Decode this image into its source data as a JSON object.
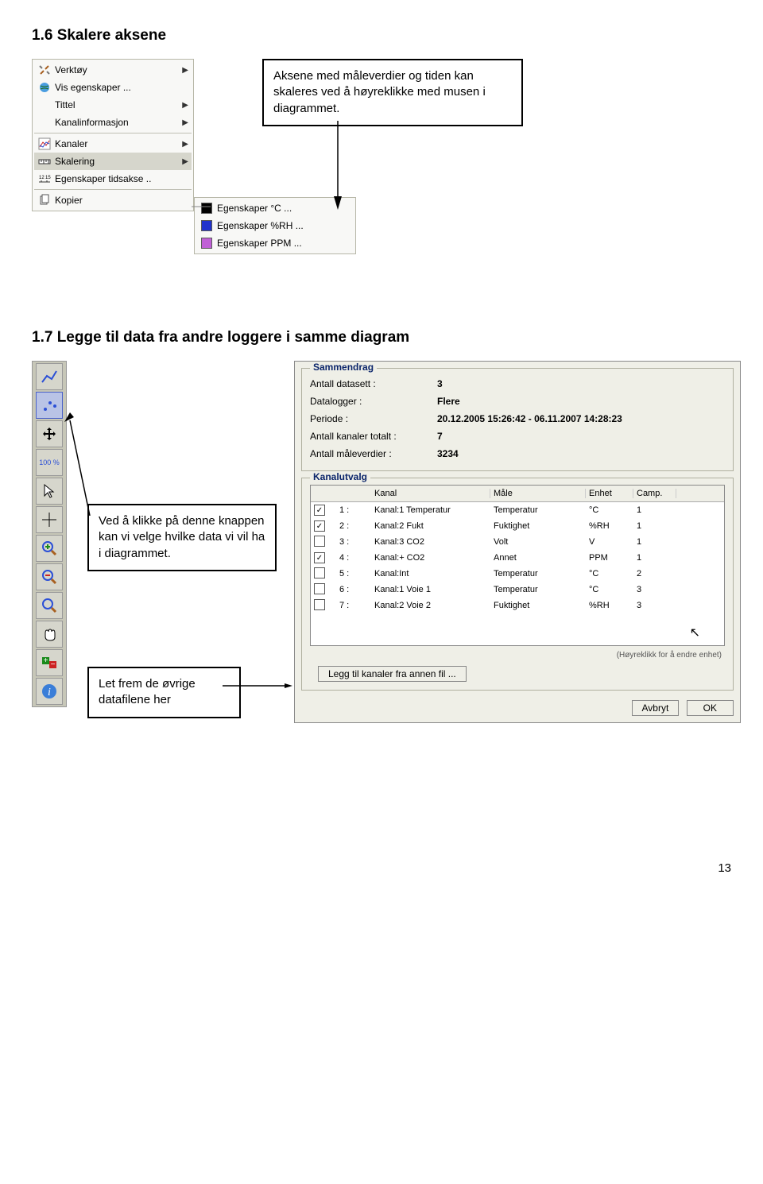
{
  "section1": {
    "heading": "1.6 Skalere aksene",
    "callout": "Aksene med måleverdier og tiden kan skaleres ved å høyreklikke med musen i diagrammet.",
    "menu": [
      {
        "icon": "tools",
        "label": "Verktøy",
        "arrow": true
      },
      {
        "icon": "globe",
        "label": "Vis egenskaper ...",
        "arrow": false
      },
      {
        "icon": "",
        "label": "Tittel",
        "arrow": true
      },
      {
        "icon": "",
        "label": "Kanalinformasjon",
        "arrow": true
      },
      {
        "sep": true
      },
      {
        "icon": "chart",
        "label": "Kanaler",
        "arrow": true
      },
      {
        "icon": "ruler",
        "label": "Skalering",
        "arrow": true,
        "sel": true
      },
      {
        "icon": "timeaxis",
        "label": "Egenskaper tidsakse ..",
        "arrow": false
      },
      {
        "sep": true
      },
      {
        "icon": "copy",
        "label": "Kopier",
        "arrow": false
      }
    ],
    "submenu": [
      {
        "color": "#000000",
        "label": "Egenskaper °C ..."
      },
      {
        "color": "#2233cc",
        "label": "Egenskaper %RH ..."
      },
      {
        "color": "#c060d6",
        "label": "Egenskaper PPM ..."
      }
    ]
  },
  "section2": {
    "heading": "1.7 Legge til data fra andre loggere i samme diagram",
    "callout_left": "Ved å klikke på denne knappen kan vi velge hvilke data vi vil ha i diagrammet.",
    "callout_bottom": "Let frem de øvrige datafilene her",
    "toolbar_labels": {
      "zoom100": "100 %"
    },
    "dialog": {
      "sammendrag_title": "Sammendrag",
      "fields": [
        {
          "k": "Antall datasett :",
          "v": "3"
        },
        {
          "k": "Datalogger :",
          "v": "Flere"
        },
        {
          "k": "Periode :",
          "v": "20.12.2005 15:26:42     -     06.11.2007 14:28:23"
        },
        {
          "k": "Antall kanaler totalt :",
          "v": "7"
        },
        {
          "k": "Antall måleverdier :",
          "v": "3234"
        }
      ],
      "kanalutvalg_title": "Kanalutvalg",
      "headers": [
        "",
        "",
        "Kanal",
        "Måle",
        "Enhet",
        "Camp."
      ],
      "rows": [
        {
          "chk": true,
          "n": "1 :",
          "kanal": "Kanal:1 Temperatur",
          "maale": "Temperatur",
          "enhet": "°C",
          "camp": "1"
        },
        {
          "chk": true,
          "n": "2 :",
          "kanal": "Kanal:2 Fukt",
          "maale": "Fuktighet",
          "enhet": "%RH",
          "camp": "1"
        },
        {
          "chk": false,
          "n": "3 :",
          "kanal": "Kanal:3 CO2",
          "maale": "Volt",
          "enhet": "V",
          "camp": "1"
        },
        {
          "chk": true,
          "n": "4 :",
          "kanal": "Kanal:+ CO2",
          "maale": "Annet",
          "enhet": "PPM",
          "camp": "1"
        },
        {
          "chk": false,
          "n": "5 :",
          "kanal": "Kanal:Int",
          "maale": "Temperatur",
          "enhet": "°C",
          "camp": "2"
        },
        {
          "chk": false,
          "n": "6 :",
          "kanal": "Kanal:1 Voie 1",
          "maale": "Temperatur",
          "enhet": "°C",
          "camp": "3"
        },
        {
          "chk": false,
          "n": "7 :",
          "kanal": "Kanal:2 Voie 2",
          "maale": "Fuktighet",
          "enhet": "%RH",
          "camp": "3"
        }
      ],
      "hint": "(Høyreklikk for å endre enhet)",
      "addfile": "Legg til kanaler fra annen fil ...",
      "avbryt": "Avbryt",
      "ok": "OK"
    }
  },
  "page_number": "13"
}
